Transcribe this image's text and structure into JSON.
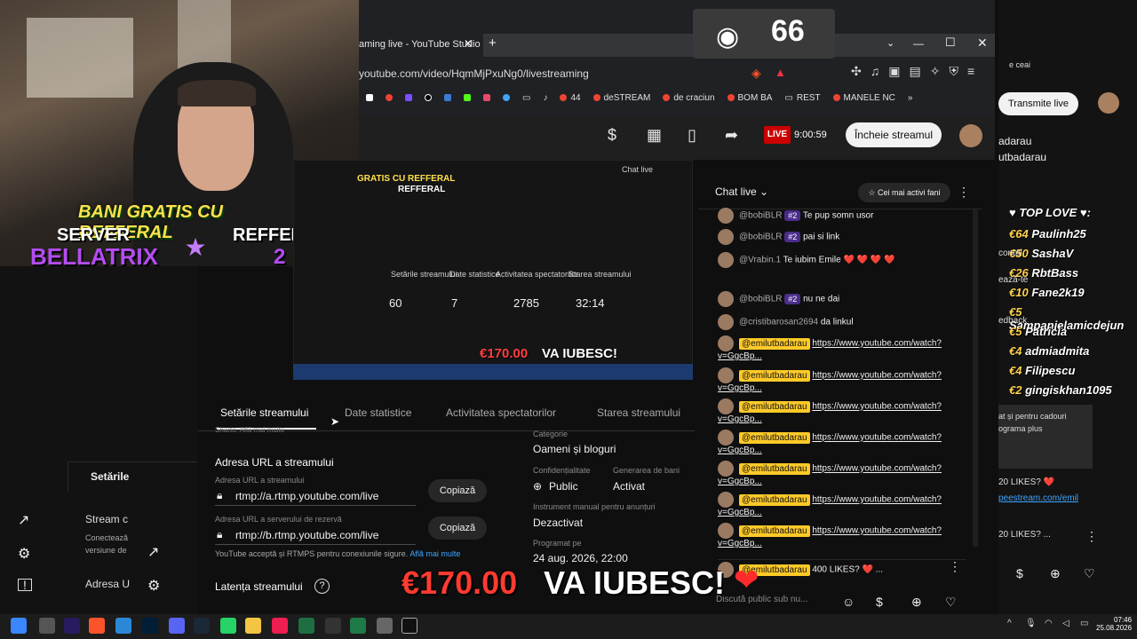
{
  "overlay": {
    "promo": "BANI GRATIS CU REFFERAL",
    "server": "SERVER",
    "bellatrix": "BELLATRIX",
    "refferal": "REFFERAL",
    "ref_num": "2",
    "viewers": "66",
    "donation_amount": "€170.00",
    "donation_text": "VA IUBESC!",
    "heart": "❤"
  },
  "browser": {
    "tab_title": "aming live - YouTube Studio",
    "url": "youtube.com/video/HqmMjPxuNg0/livestreaming",
    "bookmarks": [
      "44",
      "deSTREAM",
      "de craciun",
      "BOM BA",
      "REST",
      "MANELE NC"
    ],
    "right_bookmark": "e ceai"
  },
  "studio": {
    "live": "LIVE",
    "time": "9:00:59",
    "end_stream": "Încheie streamul",
    "right_button": "Transmite live"
  },
  "preview": {
    "tabs": [
      "Setările streamului",
      "Date statistice",
      "Activitatea spectatorilor",
      "Starea streamului"
    ],
    "stats": [
      "60",
      "7",
      "2785",
      "32:14"
    ],
    "overlay_line1": "GRATIS CU REFFERAL",
    "overlay_line2": "REFFERAL",
    "chat_label": "Chat live"
  },
  "settings": {
    "tabs": [
      "Setările streamului",
      "Date statistice",
      "Activitatea spectatorilor",
      "Starea streamului"
    ],
    "url_section": "Adresa URL a streamului",
    "primary_label": "Adresa URL a streamului",
    "primary_value": "rtmp://a.rtmp.youtube.com/live",
    "backup_label": "Adresa URL a serverului de rezervă",
    "backup_value": "rtmp://b.rtmp.youtube.com/live",
    "copy": "Copiază",
    "note": "YouTube acceptă și RTMPS pentru conexiunile sigure.",
    "note_link": "Află mai multe",
    "latency": "Latența streamului",
    "category_label": "Categorie",
    "category": "Oameni și bloguri",
    "privacy_label": "Confidențialitate",
    "privacy": "Public",
    "monetization_label": "Generarea de bani",
    "monetization": "Activat",
    "ads_label": "Instrument manual pentru anunțuri",
    "ads": "Dezactivat",
    "scheduled_label": "Programat pe",
    "scheduled": "24 aug. 2026, 22:00",
    "cut_top": "Sharto. Află mai multe"
  },
  "left_studio": {
    "settings": "Setările",
    "stream": "Stream c",
    "connect": "Conectează",
    "version": "versiune de",
    "address": "Adresa U"
  },
  "chat": {
    "title": "Chat live",
    "top_fans": "Cei mai activi fani",
    "input_placeholder": "Discută public sub nu...",
    "messages": [
      {
        "name": "@bobiBLR",
        "badge": "#2",
        "text": "Te pup somn usor"
      },
      {
        "name": "@bobiBLR",
        "badge": "#2",
        "text": "pai si link"
      },
      {
        "name": "@Vrabin.1",
        "badge": "",
        "text": "Te iubim Emile ❤️ ❤️ ❤️ ❤️"
      },
      {
        "name": "@bobiBLR",
        "badge": "#2",
        "text": "nu ne dai"
      },
      {
        "name": "@cristibarosan2694",
        "badge": "",
        "text": "da linkul"
      },
      {
        "name": "@emilutbadarau",
        "badge": "",
        "text": "https://www.youtube.com/watch?v=GgcBp..."
      },
      {
        "name": "@emilutbadarau",
        "badge": "",
        "text": "https://www.youtube.com/watch?v=GgcBp..."
      },
      {
        "name": "@emilutbadarau",
        "badge": "",
        "text": "https://www.youtube.com/watch?v=GgcBp..."
      },
      {
        "name": "@emilutbadarau",
        "badge": "",
        "text": "https://www.youtube.com/watch?v=GgcBp..."
      },
      {
        "name": "@emilutbadarau",
        "badge": "",
        "text": "https://www.youtube.com/watch?v=GgcBp..."
      },
      {
        "name": "@emilutbadarau",
        "badge": "",
        "text": "https://www.youtube.com/watch?v=GgcBp..."
      },
      {
        "name": "@emilutbadarau",
        "badge": "",
        "text": "https://www.youtube.com/watch?v=GgcBp..."
      }
    ],
    "pinned": {
      "name": "@emilutbadarau",
      "text": "400 LIKES? ❤️ ..."
    }
  },
  "right_overlay": {
    "name_line1": "adarau",
    "name_line2": "utbadarau",
    "top_love": "♥ TOP LOVE ♥:",
    "donors": [
      {
        "amount": "€64",
        "name": "Paulinh25"
      },
      {
        "amount": "€50",
        "name": "SashaV"
      },
      {
        "amount": "€26",
        "name": "RbtBass"
      },
      {
        "amount": "€10",
        "name": "Fane2k19"
      },
      {
        "amount": "€5",
        "name": "Sampanielamicdejun"
      },
      {
        "amount": "€5",
        "name": "Patricia"
      },
      {
        "amount": "€4",
        "name": "admiadmita"
      },
      {
        "amount": "€4",
        "name": "Filipescu"
      },
      {
        "amount": "€2",
        "name": "gingiskhan1095"
      }
    ],
    "side_words": [
      "contul",
      "ează-te",
      "edback"
    ],
    "promo1": "at și pentru cadouri",
    "promo2": "ograma plus",
    "likes1": "20 LIKES? ❤️",
    "link": "peestream.com/emil",
    "likes2": "20 LIKES? ..."
  },
  "taskbar": {
    "time": "07:46",
    "date": "25.08.2026"
  }
}
